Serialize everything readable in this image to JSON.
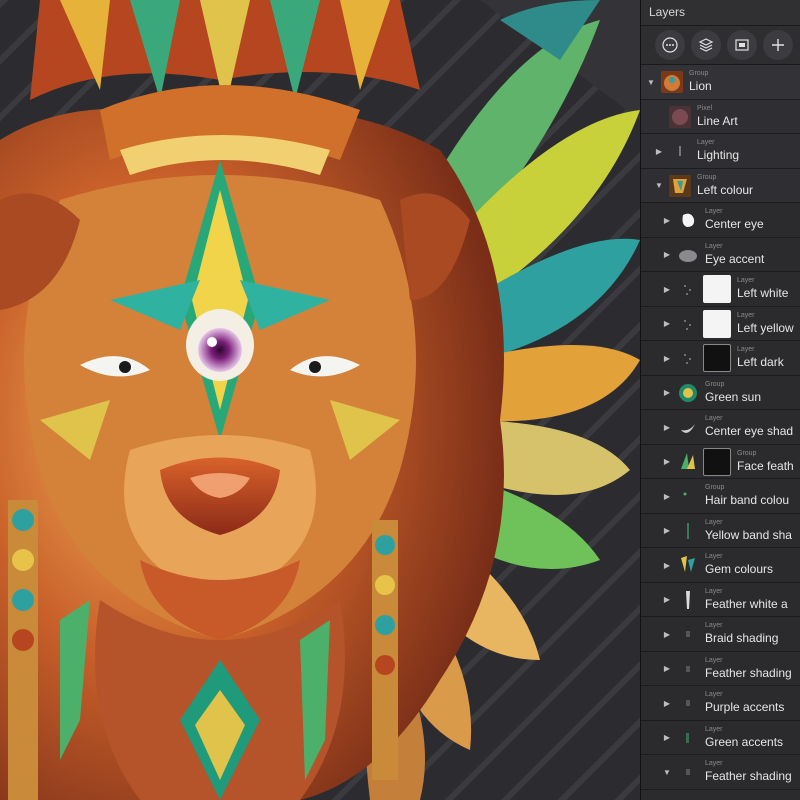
{
  "panel": {
    "title": "Layers",
    "toolbar": [
      {
        "name": "more-options-icon",
        "glyph": "⋯"
      },
      {
        "name": "layers-stack-icon",
        "glyph": ""
      },
      {
        "name": "mask-icon",
        "glyph": ""
      },
      {
        "name": "add-layer-icon",
        "glyph": "+"
      }
    ]
  },
  "layers": [
    {
      "type": "Group",
      "name": "Lion",
      "chevron": "down",
      "depth": 0,
      "thumb": "lion"
    },
    {
      "type": "Pixel",
      "name": "Line Art",
      "chevron": "",
      "depth": 1,
      "thumb": "pink"
    },
    {
      "type": "Layer",
      "name": "Lighting",
      "chevron": "right",
      "depth": 1,
      "thumb": "dot"
    },
    {
      "type": "Group",
      "name": "Left colour",
      "chevron": "down",
      "depth": 1,
      "thumb": "colour"
    },
    {
      "type": "Layer",
      "name": "Center eye",
      "chevron": "right",
      "depth": 2,
      "thumb": "white-blob"
    },
    {
      "type": "Layer",
      "name": "Eye accent",
      "chevron": "right",
      "depth": 2,
      "thumb": "grey-blob"
    },
    {
      "type": "Layer",
      "name": "Left white",
      "chevron": "right",
      "depth": 2,
      "thumb": "speck",
      "mask": "white"
    },
    {
      "type": "Layer",
      "name": "Left yellow",
      "chevron": "right",
      "depth": 2,
      "thumb": "speck",
      "mask": "white"
    },
    {
      "type": "Layer",
      "name": "Left dark",
      "chevron": "right",
      "depth": 2,
      "thumb": "speck",
      "mask": "dark"
    },
    {
      "type": "Group",
      "name": "Green sun",
      "chevron": "right",
      "depth": 2,
      "thumb": "green-sun"
    },
    {
      "type": "Layer",
      "name": "Center eye shad",
      "chevron": "right",
      "depth": 2,
      "thumb": "crescent"
    },
    {
      "type": "Group",
      "name": "Face feath",
      "chevron": "right",
      "depth": 2,
      "thumb": "feathers",
      "mask": "dark"
    },
    {
      "type": "Group",
      "name": "Hair band colou",
      "chevron": "right",
      "depth": 2,
      "thumb": "dot-green"
    },
    {
      "type": "Layer",
      "name": "Yellow band sha",
      "chevron": "right",
      "depth": 2,
      "thumb": "green-line"
    },
    {
      "type": "Layer",
      "name": "Gem colours",
      "chevron": "right",
      "depth": 2,
      "thumb": "gems"
    },
    {
      "type": "Layer",
      "name": "Feather white a",
      "chevron": "right",
      "depth": 2,
      "thumb": "white-feather"
    },
    {
      "type": "Layer",
      "name": "Braid shading",
      "chevron": "right",
      "depth": 2,
      "thumb": "faint"
    },
    {
      "type": "Layer",
      "name": "Feather shading",
      "chevron": "right",
      "depth": 2,
      "thumb": "faint"
    },
    {
      "type": "Layer",
      "name": "Purple accents",
      "chevron": "right",
      "depth": 2,
      "thumb": "faint"
    },
    {
      "type": "Layer",
      "name": "Green accents",
      "chevron": "right",
      "depth": 2,
      "thumb": "faint-green"
    },
    {
      "type": "Layer",
      "name": "Feather shading",
      "chevron": "down",
      "depth": 2,
      "thumb": "faint"
    }
  ],
  "colors": {
    "panel_bg": "#2b2b2e",
    "canvas_bg": "#2a2a2e",
    "text": "#e6e6e6",
    "subtext": "#8a8a8e"
  }
}
